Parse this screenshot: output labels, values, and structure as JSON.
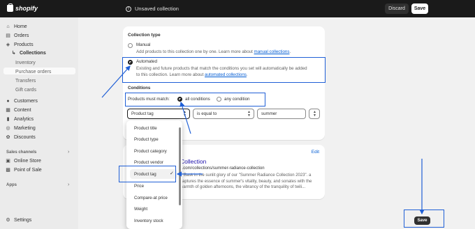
{
  "topbar": {
    "logo_text": "shopify",
    "title": "Unsaved collection",
    "discard_label": "Discard",
    "save_label": "Save"
  },
  "sidebar": {
    "items": [
      {
        "label": "Home",
        "icon": "home-icon"
      },
      {
        "label": "Orders",
        "icon": "orders-icon"
      },
      {
        "label": "Products",
        "icon": "products-icon"
      },
      {
        "label": "Collections",
        "icon": "collections-icon"
      },
      {
        "label": "Inventory"
      },
      {
        "label": "Purchase orders"
      },
      {
        "label": "Transfers"
      },
      {
        "label": "Gift cards"
      },
      {
        "label": "Customers",
        "icon": "customers-icon"
      },
      {
        "label": "Content",
        "icon": "content-icon"
      },
      {
        "label": "Analytics",
        "icon": "analytics-icon"
      },
      {
        "label": "Marketing",
        "icon": "marketing-icon"
      },
      {
        "label": "Discounts",
        "icon": "discounts-icon"
      }
    ],
    "sales_channels_label": "Sales channels",
    "channels": [
      {
        "label": "Online Store",
        "icon": "online-store-icon"
      },
      {
        "label": "Point of Sale",
        "icon": "point-of-sale-icon"
      }
    ],
    "apps_label": "Apps",
    "settings_label": "Settings"
  },
  "collection_type": {
    "heading": "Collection type",
    "manual_label": "Manual",
    "manual_desc": "Add products to this collection one by one. Learn more about ",
    "manual_link": "manual collections",
    "automated_label": "Automated",
    "automated_desc_1": "Existing and future products that match the conditions you set will automatically be added",
    "automated_desc_2": "to this collection. Learn more about ",
    "automated_link": "automated collections",
    "selected": "Automated"
  },
  "conditions": {
    "heading": "Conditions",
    "must_match_label": "Products must match:",
    "all_label": "all conditions",
    "any_label": "any condition",
    "field_value": "Product tag",
    "operator_value": "is equal to",
    "value_input": "summer"
  },
  "dropdown": {
    "options": [
      "Product title",
      "Product type",
      "Product category",
      "Product vendor",
      "Product tag",
      "Price",
      "Compare-at price",
      "Weight",
      "Inventory stock"
    ],
    "selected": "Product tag"
  },
  "preview": {
    "edit_label": "Edit",
    "title": "Collection",
    "url": "y.com/collections/summer-radiance-collection",
    "desc": "n Bask in the sunlit glory of our \"Summer Radiance Collection 2023\". a captures the essence of summer's vitality, beauty, and sonates with the warmth of golden afternoons, the vibrancy of the tranquility of twili..."
  },
  "save_bottom_label": "Save",
  "colors": {
    "topbar": "#1a1a1a",
    "annotation": "#1f5fd6",
    "link": "#005bd3"
  }
}
